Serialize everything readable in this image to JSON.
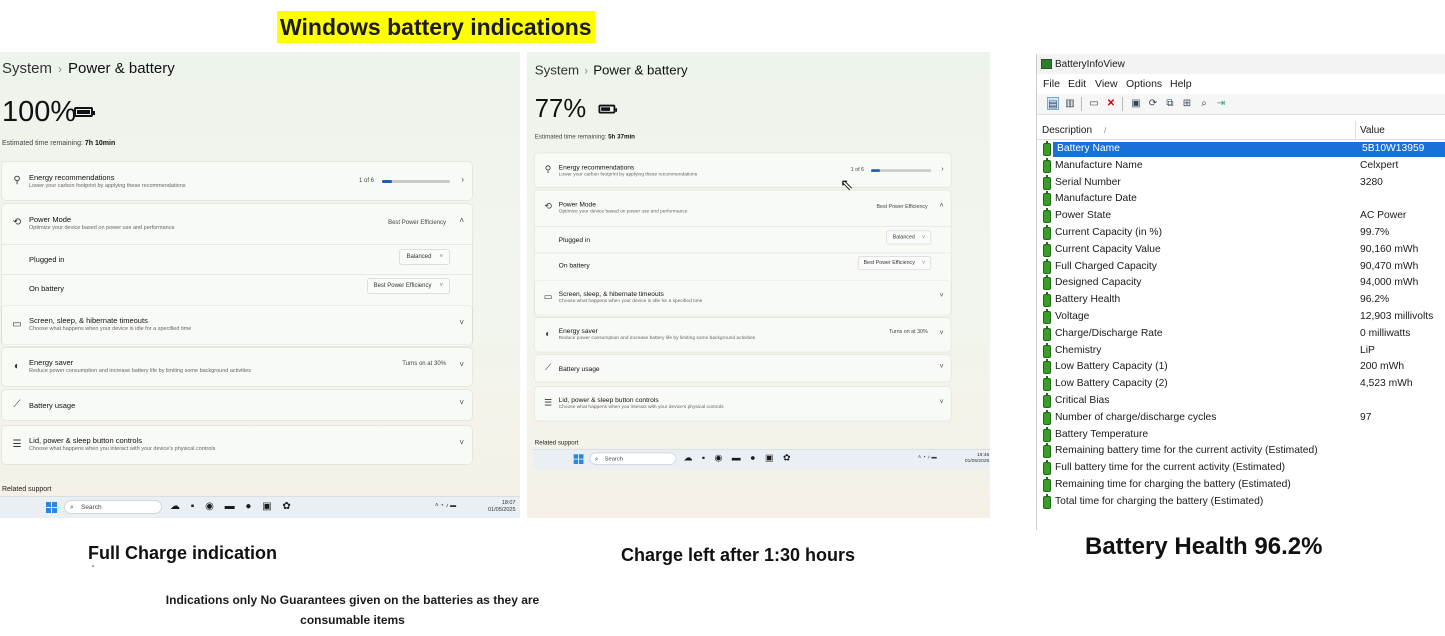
{
  "heading": "Windows battery indications",
  "settings_full": {
    "breadcrumb_parent": "System",
    "breadcrumb_current": "Power & battery",
    "percent": "100%",
    "battery_fill": 1.0,
    "estimate_label": "Estimated time remaining:",
    "estimate_value": "7h 10min",
    "energy_title": "Energy recommendations",
    "energy_sub": "Lower your carbon footprint by applying these recommendations",
    "energy_count": "1 of 6",
    "energy_progress": 0.17,
    "power_mode_title": "Power Mode",
    "power_mode_sub": "Optimize your device based on power use and performance",
    "power_mode_value": "Best Power Efficiency",
    "plugged_in_label": "Plugged in",
    "plugged_in_value": "Balanced",
    "on_battery_label": "On battery",
    "on_battery_value": "Best Power Efficiency",
    "screen_title": "Screen, sleep, & hibernate timeouts",
    "screen_sub": "Choose what happens when your device is idle for a specified time",
    "saver_title": "Energy saver",
    "saver_sub": "Reduce power consumption and increase battery life by limiting some background activities",
    "saver_value": "Turns on at 30%",
    "usage_title": "Battery usage",
    "lid_title": "Lid, power & sleep button controls",
    "lid_sub": "Choose what happens when you interact with your device's physical controls",
    "related": "Related support",
    "search": "Search",
    "clock_time": "18:07",
    "clock_date": "01/05/2025"
  },
  "settings_partial": {
    "breadcrumb_parent": "System",
    "breadcrumb_current": "Power & battery",
    "percent": "77%",
    "battery_fill": 0.77,
    "estimate_label": "Estimated time remaining:",
    "estimate_value": "5h 37min",
    "energy_title": "Energy recommendations",
    "energy_sub": "Lower your carbon footprint by applying these recommendations",
    "energy_count": "1 of 6",
    "energy_progress": 0.17,
    "power_mode_title": "Power Mode",
    "power_mode_sub": "Optimize your device based on power use and performance",
    "power_mode_value": "Best Power Efficiency",
    "plugged_in_label": "Plugged in",
    "plugged_in_value": "Balanced",
    "on_battery_label": "On battery",
    "on_battery_value": "Best Power Efficiency",
    "screen_title": "Screen, sleep, & hibernate timeouts",
    "screen_sub": "Choose what happens when your device is idle for a specified time",
    "saver_title": "Energy saver",
    "saver_sub": "Reduce power consumption and increase battery life by limiting some background activities",
    "saver_value": "Turns on at 30%",
    "usage_title": "Battery usage",
    "lid_title": "Lid, power & sleep button controls",
    "lid_sub": "Choose what happens when you interact with your device's physical controls",
    "related": "Related support",
    "search": "Search",
    "clock_time": "19:45",
    "clock_date": "01/05/2025"
  },
  "biv": {
    "title": "BatteryInfoView",
    "menu": [
      "File",
      "Edit",
      "View",
      "Options",
      "Help"
    ],
    "col_description": "Description",
    "col_value": "Value",
    "rows": [
      {
        "d": "Battery Name",
        "v": "5B10W13959"
      },
      {
        "d": "Manufacture Name",
        "v": "Celxpert"
      },
      {
        "d": "Serial Number",
        "v": "3280"
      },
      {
        "d": "Manufacture Date",
        "v": ""
      },
      {
        "d": "Power State",
        "v": "AC Power"
      },
      {
        "d": "Current Capacity (in %)",
        "v": "99.7%"
      },
      {
        "d": "Current Capacity Value",
        "v": "90,160 mWh"
      },
      {
        "d": "Full Charged Capacity",
        "v": "90,470 mWh"
      },
      {
        "d": "Designed Capacity",
        "v": "94,000 mWh"
      },
      {
        "d": "Battery Health",
        "v": "96.2%"
      },
      {
        "d": "Voltage",
        "v": "12,903 millivolts"
      },
      {
        "d": "Charge/Discharge Rate",
        "v": "0 milliwatts"
      },
      {
        "d": "Chemistry",
        "v": "LiP"
      },
      {
        "d": "Low Battery Capacity (1)",
        "v": "200 mWh"
      },
      {
        "d": "Low Battery Capacity (2)",
        "v": "4,523 mWh"
      },
      {
        "d": "Critical Bias",
        "v": ""
      },
      {
        "d": "Number of charge/discharge cycles",
        "v": "97"
      },
      {
        "d": "Battery Temperature",
        "v": ""
      },
      {
        "d": "Remaining battery time for the current activity (Estimated)",
        "v": ""
      },
      {
        "d": "Full battery time for the current activity (Estimated)",
        "v": ""
      },
      {
        "d": "Remaining time for charging the battery (Estimated)",
        "v": ""
      },
      {
        "d": "Total  time for charging the battery (Estimated)",
        "v": ""
      }
    ]
  },
  "captions": {
    "full": "Full Charge indication",
    "partial": "Charge left after 1:30 hours",
    "health": "Battery Health 96.2%",
    "note": "Indications only No Guarantees given on the batteries as they are consumable items"
  }
}
